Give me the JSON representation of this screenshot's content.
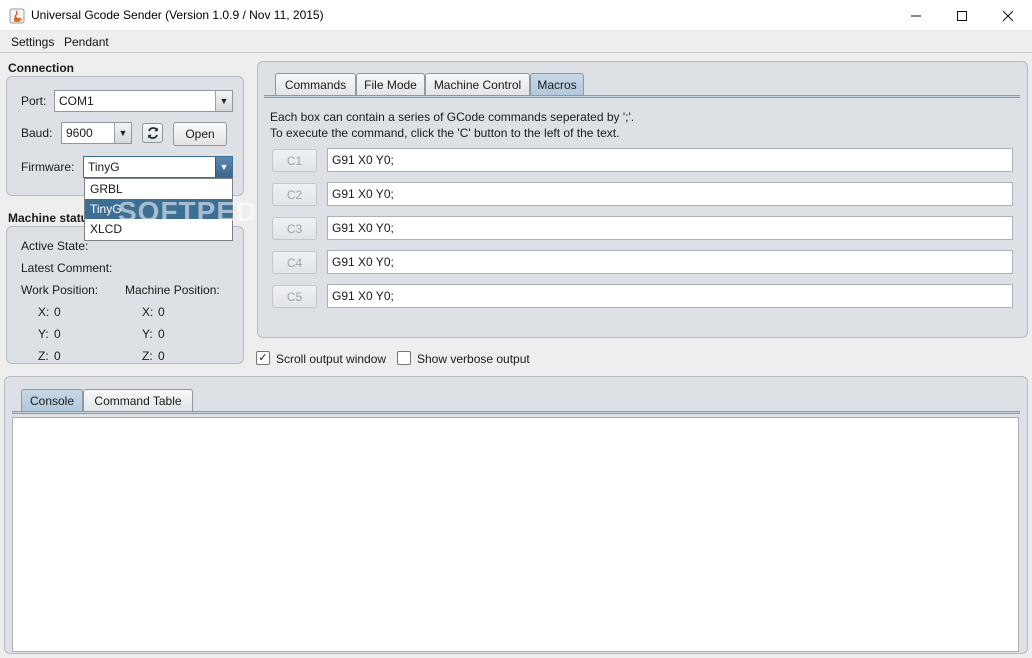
{
  "window": {
    "title": "Universal Gcode Sender (Version 1.0.9 / Nov 11, 2015)",
    "controls": [
      "minimize-icon",
      "maximize-icon",
      "close-icon"
    ]
  },
  "menu": {
    "items": [
      "Settings",
      "Pendant"
    ]
  },
  "connection": {
    "title": "Connection",
    "port_label": "Port:",
    "port_value": "COM1",
    "baud_label": "Baud:",
    "baud_value": "9600",
    "refresh_icon": "refresh-icon",
    "open_label": "Open",
    "firmware_label": "Firmware:",
    "firmware_value": "TinyG",
    "firmware_options": [
      "GRBL",
      "TinyG",
      "XLCD"
    ],
    "firmware_selected_index": 1
  },
  "machine_status": {
    "title": "Machine status",
    "active_state_label": "Active State:",
    "latest_comment_label": "Latest Comment:",
    "work_position_label": "Work Position:",
    "machine_position_label": "Machine Position:",
    "work": {
      "x_label": "X:",
      "x": "0",
      "y_label": "Y:",
      "y": "0",
      "z_label": "Z:",
      "z": "0"
    },
    "machine": {
      "x_label": "X:",
      "x": "0",
      "y_label": "Y:",
      "y": "0",
      "z_label": "Z:",
      "z": "0"
    }
  },
  "tabs": {
    "items": [
      "Commands",
      "File Mode",
      "Machine Control",
      "Macros"
    ],
    "active_index": 3
  },
  "macros": {
    "help_line1": "Each box can contain a series of GCode commands seperated by ';'.",
    "help_line2": "To execute the command, click the 'C' button to the left of the text.",
    "rows": [
      {
        "button": "C1",
        "value": "G91 X0 Y0;"
      },
      {
        "button": "C2",
        "value": "G91 X0 Y0;"
      },
      {
        "button": "C3",
        "value": "G91 X0 Y0;"
      },
      {
        "button": "C4",
        "value": "G91 X0 Y0;"
      },
      {
        "button": "C5",
        "value": "G91 X0 Y0;"
      }
    ]
  },
  "options": {
    "scroll_output_label": "Scroll output window",
    "scroll_output_checked": true,
    "verbose_output_label": "Show verbose output",
    "verbose_output_checked": false
  },
  "console": {
    "tabs": [
      "Console",
      "Command Table"
    ],
    "active_index": 0,
    "text": ""
  },
  "watermark": "SOFTPEDIA",
  "colors": {
    "panel_bg": "#dde1e6",
    "active_tab": "#b8cadb",
    "selection": "#3d6e94"
  }
}
